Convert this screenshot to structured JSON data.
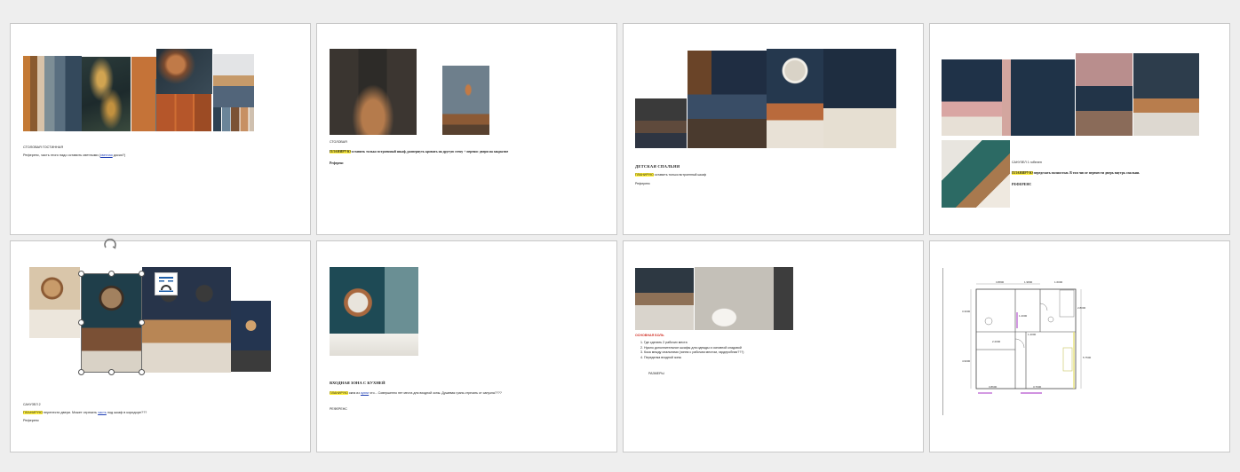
{
  "slides": {
    "s1": {
      "title": "СТОЛОВАЯ ГОСТИННАЯ",
      "text_before_link": "Референс, часть этого надо оставить светлыми (",
      "link": "светлая",
      "text_after_link": " доски?)"
    },
    "s2": {
      "title": "СТОЛОВАЯ",
      "highlight": "ПЛАНИРУЮ",
      "text": " оставить только встроенный шкаф, развернуть кровать на другую стену + перенос двери на закрытие",
      "ref": "Референс"
    },
    "s3": {
      "title": "ДЕТСКАЯ СПАЛЬНЯ",
      "highlight": "ПЛАНИРУЮ",
      "text": " оставить только встроенный шкаф",
      "ref": "Референс"
    },
    "s4": {
      "title": "САНУЗЕЛ 1 гобелен",
      "highlight": "ПЛАНИРУЮ",
      "text": " переделать полностью. В том числе перенести дверь внутрь спальни.",
      "ref": "РЕФЕРЕНС"
    },
    "s5": {
      "title": "САНУЗЕЛ 2",
      "highlight": "ПЛАНИРУЮ",
      "text_before_link": " перенести двери. Может отрезать ",
      "link": "часть",
      "text_after_link": " под шкаф в коридоре???",
      "ref": "Референс"
    },
    "s6": {
      "title": "ВХОДНАЯ ЗОНА С КУХНЕЙ",
      "highlight": "ПЛАНИРУЮ",
      "text_before_link": " окна из ",
      "link": "кухни",
      "text_after_link": " что... Совершенно нет места для входной зоны. Душевая грань отрезать от санузла????",
      "ref": "РЕФЕРЕНС"
    },
    "s7": {
      "title": "ОСНОВНАЯ БОЛЬ",
      "items": [
        "Где сделать 2 рабочих места",
        "Нужно дополнительное шкафы для одежды и основной кладовой",
        "Кока между спальнями (чиппи с рабочим местом, гардеробная???)",
        "Переделка входной зоны"
      ],
      "ref": "РАЗМЕРЫ"
    },
    "s8": {
      "dims": [
        "3.8800",
        "1.9800",
        "1.6000",
        "3.3000",
        "2.8000",
        "1.2000",
        "4.9000",
        "5.7500",
        "3.8600",
        "3.7600",
        "2.2000",
        "1.4000"
      ]
    }
  },
  "icons": {
    "rotate": "rotate-handle-icon",
    "layout": "layout-options-icon"
  },
  "colors": {
    "navy": "#2f4357",
    "rust": "#b8622d",
    "teal": "#2c4d59",
    "highlight": "#ffef3a",
    "link": "#1f3fb5",
    "pain_red": "#d2342a",
    "plan_purple": "#c06fd6",
    "plan_yellow": "#e8e27a"
  }
}
